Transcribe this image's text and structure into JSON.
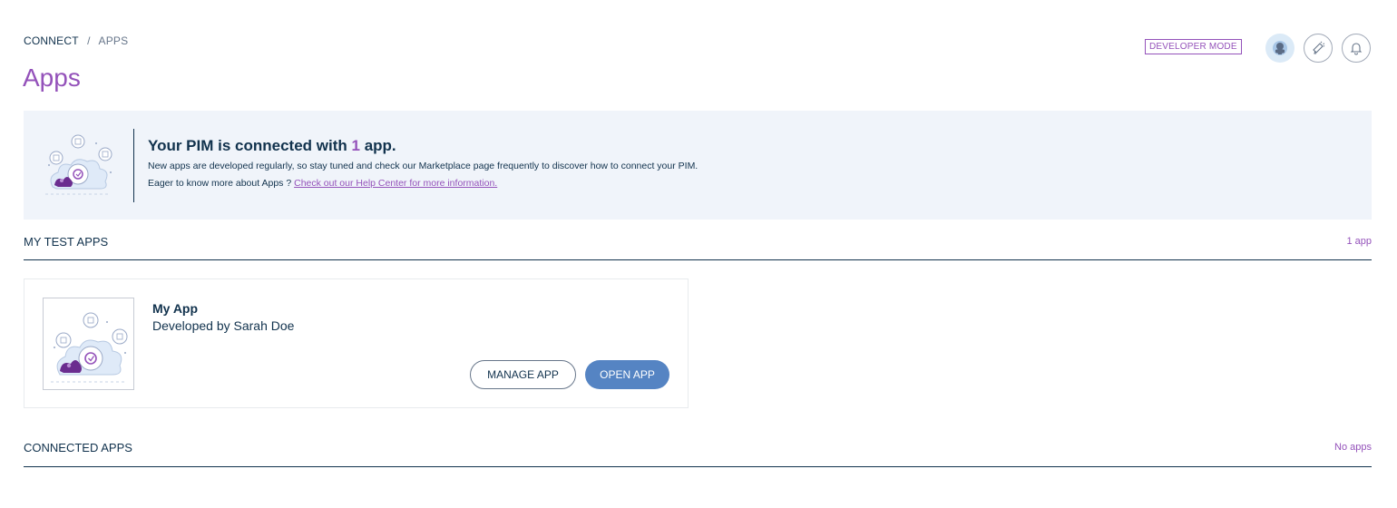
{
  "breadcrumb": {
    "root": "CONNECT",
    "separator": "/",
    "current": "APPS"
  },
  "page_title": "Apps",
  "header": {
    "developer_mode_label": "DEVELOPER MODE",
    "avatar_icon": "user-avatar-icon",
    "announcements_icon": "megaphone-icon",
    "notifications_icon": "bell-icon"
  },
  "info_banner": {
    "title_prefix": "Your PIM is connected with",
    "title_count": "1",
    "title_suffix": "app.",
    "line1": "New apps are developed regularly, so stay tuned and check our Marketplace page frequently to discover how to connect your PIM.",
    "line2_prefix": "Eager to know more about Apps ?",
    "line2_link": "Check out our Help Center for more information."
  },
  "sections": {
    "test_apps": {
      "title": "MY TEST APPS",
      "count": "1 app"
    },
    "connected_apps": {
      "title": "CONNECTED APPS",
      "count": "No apps"
    }
  },
  "test_app": {
    "name": "My App",
    "author": "Developed by Sarah Doe",
    "manage_label": "MANAGE APP",
    "open_label": "OPEN APP"
  },
  "colors": {
    "brand_purple": "#9452ba",
    "primary_blue": "#5584c3",
    "text_dark": "#11324d",
    "banner_bg": "#f0f4fa"
  }
}
